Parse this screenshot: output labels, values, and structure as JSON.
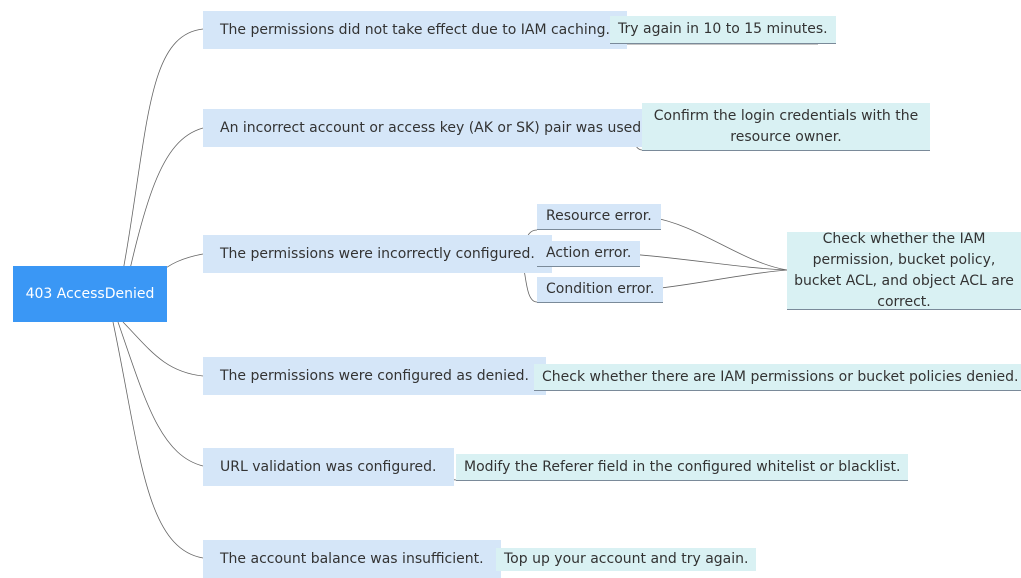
{
  "root": {
    "label": "403 AccessDenied"
  },
  "causes": [
    {
      "label": "The permissions did not take effect due to IAM caching."
    },
    {
      "label": "An incorrect account or access key (AK or SK) pair was used."
    },
    {
      "label": "The permissions were incorrectly configured."
    },
    {
      "label": "The permissions were configured as denied."
    },
    {
      "label": "URL validation was configured."
    },
    {
      "label": "The account balance was insufficient."
    }
  ],
  "sub_causes": [
    {
      "label": "Resource error."
    },
    {
      "label": "Action error."
    },
    {
      "label": "Condition error."
    }
  ],
  "solutions": [
    {
      "label": "Try again in 10 to 15 minutes."
    },
    {
      "label": "Confirm the login credentials with the resource owner."
    },
    {
      "label": "Check whether the IAM permission, bucket policy, bucket ACL, and object ACL are correct."
    },
    {
      "label": "Check whether there are IAM permissions or bucket policies denied."
    },
    {
      "label": "Modify the Referer field in the configured whitelist or blacklist."
    },
    {
      "label": "Top up your account and try again."
    }
  ]
}
